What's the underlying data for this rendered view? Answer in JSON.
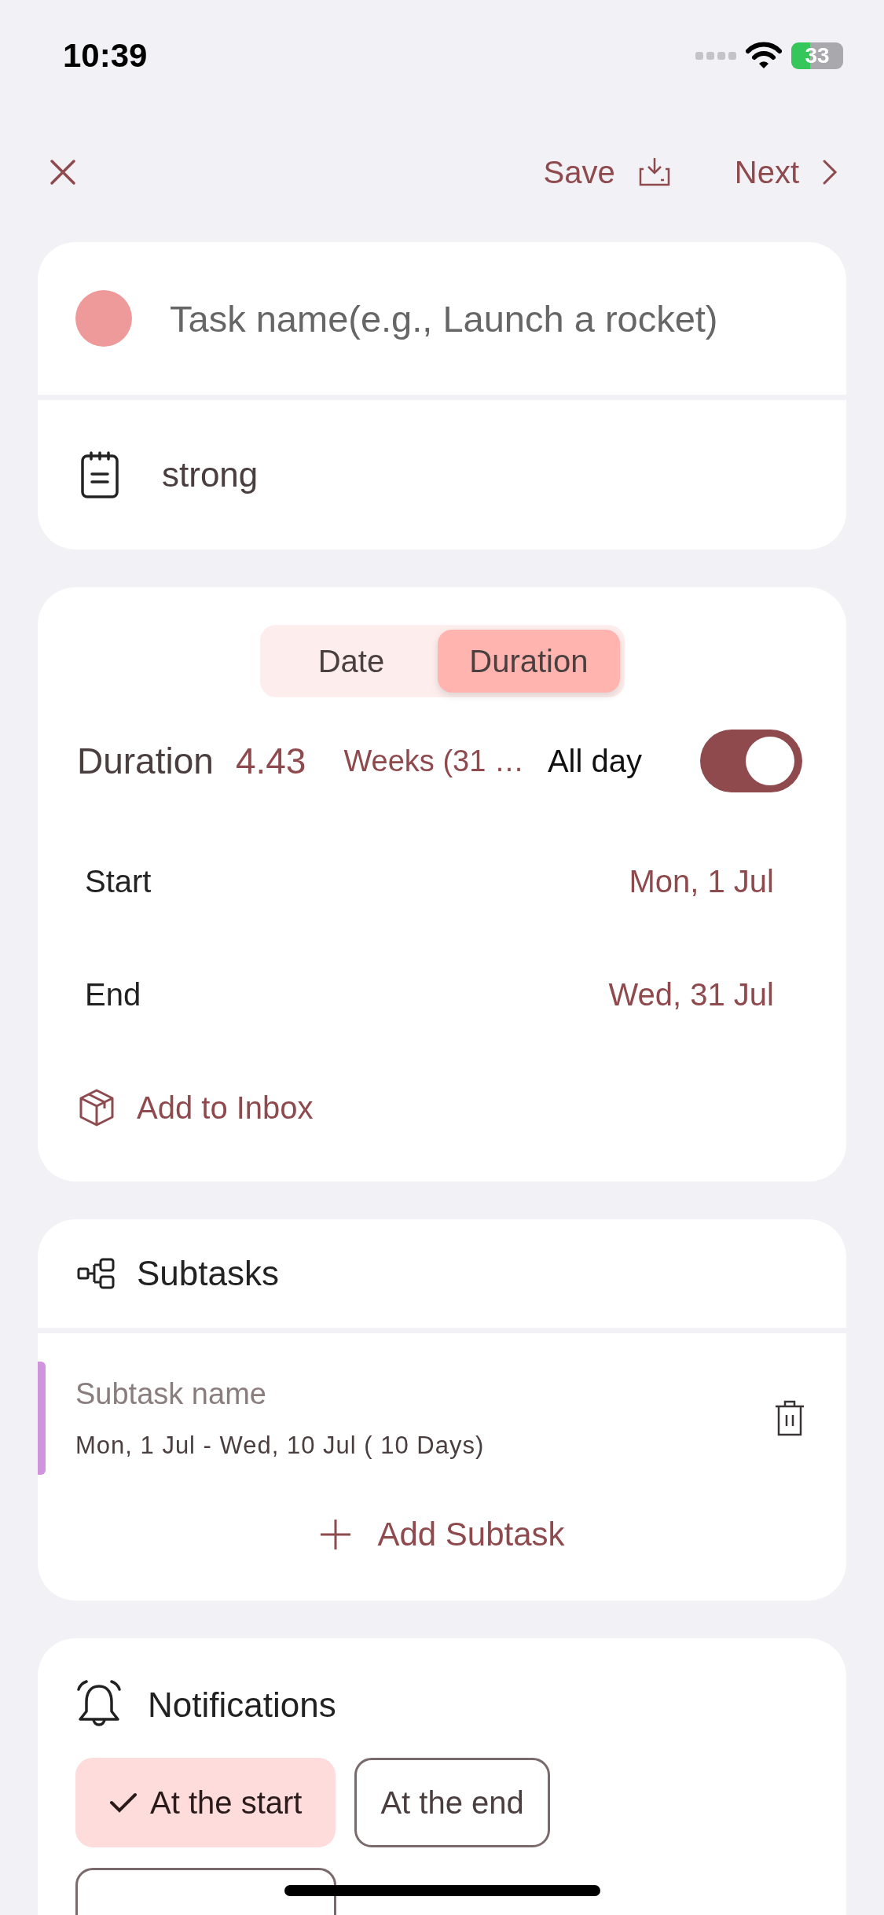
{
  "status_bar": {
    "time": "10:39",
    "battery": "33"
  },
  "nav": {
    "save": "Save",
    "next": "Next"
  },
  "task": {
    "placeholder": "Task name(e.g., Launch a rocket)",
    "color": "#ee9a9a",
    "notes": "strong"
  },
  "schedule": {
    "tabs": [
      {
        "label": "Date",
        "selected": false
      },
      {
        "label": "Duration",
        "selected": true
      }
    ],
    "duration_label": "Duration",
    "duration_value": "4.43",
    "duration_unit": "Weeks (31 …",
    "all_day_label": "All day",
    "all_day_on": true,
    "rows": [
      {
        "label": "Start",
        "value": "Mon, 1 Jul"
      },
      {
        "label": "End",
        "value": "Wed, 31 Jul"
      }
    ],
    "inbox": "Add to Inbox"
  },
  "subtasks": {
    "title": "Subtasks",
    "items": [
      {
        "placeholder": "Subtask name",
        "dates": "Mon, 1 Jul - Wed, 10 Jul ( 10 Days)",
        "color": "#cf94dc"
      }
    ],
    "add": "Add Subtask"
  },
  "notifications": {
    "title": "Notifications",
    "options": [
      {
        "label": "At the start",
        "selected": true
      },
      {
        "label": "At the end",
        "selected": false
      },
      {
        "selected": false
      }
    ]
  }
}
